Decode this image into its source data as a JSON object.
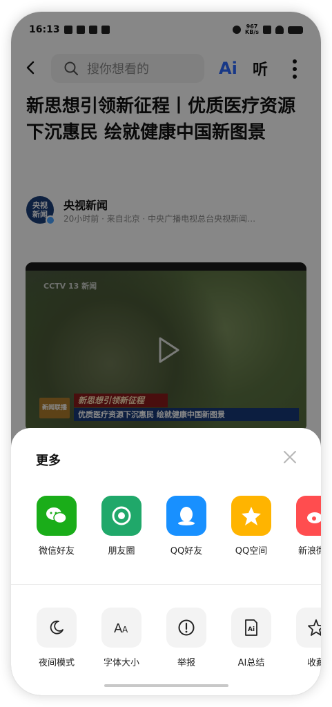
{
  "status_bar": {
    "time": "16:13",
    "net_speed_value": "967",
    "net_speed_unit": "KB/s"
  },
  "top_bar": {
    "search_placeholder": "搜你想看的",
    "ai_label": "Ai",
    "listen_label": "听"
  },
  "article": {
    "title": "新思想引领新征程丨优质医疗资源下沉惠民 绘就健康中国新图景",
    "author_name": "央视新闻",
    "avatar_text": "央视新闻",
    "meta": "20小时前 · 来自北京 · 中央广播电视总台央视新闻…"
  },
  "video": {
    "watermark": "CCTV 13 新闻",
    "banner_title": "新思想引领新征程",
    "banner_subtitle": "优质医疗资源下沉惠民 绘就健康中国新图景",
    "channel_logo": "新闻联播"
  },
  "share_sheet": {
    "title": "更多",
    "share_items": [
      {
        "label": "微信好友",
        "icon": "wechat-icon",
        "color": "#1aad19"
      },
      {
        "label": "朋友圈",
        "icon": "moments-icon",
        "color": "#20a86a"
      },
      {
        "label": "QQ好友",
        "icon": "qq-icon",
        "color": "#1890ff"
      },
      {
        "label": "QQ空间",
        "icon": "qzone-icon",
        "color": "#ffb400"
      },
      {
        "label": "新浪微博",
        "icon": "weibo-icon",
        "color": "#ff4d4f"
      }
    ],
    "tool_items": [
      {
        "label": "夜间模式",
        "icon": "moon-icon"
      },
      {
        "label": "字体大小",
        "icon": "font-size-icon"
      },
      {
        "label": "举报",
        "icon": "report-icon"
      },
      {
        "label": "AI总结",
        "icon": "ai-summary-icon"
      },
      {
        "label": "收藏",
        "icon": "star-icon"
      }
    ]
  }
}
